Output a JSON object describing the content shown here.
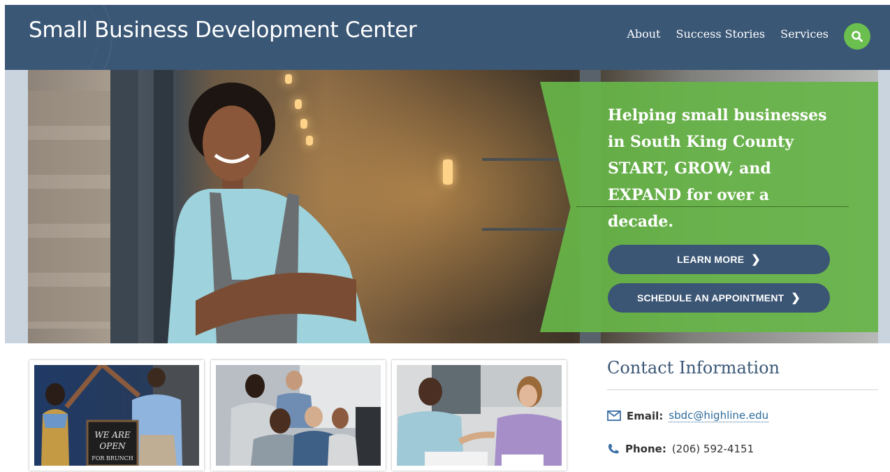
{
  "header": {
    "title": "Small Business Development Center",
    "nav": [
      {
        "label": "About"
      },
      {
        "label": "Success Stories"
      },
      {
        "label": "Services"
      }
    ],
    "search_icon": "search-icon",
    "bg_color": "#3a5776",
    "accent_color": "#6bbf4e"
  },
  "hero": {
    "tagline": "Helping small businesses in South King County START, GROW, and EXPAND for over a decade.",
    "buttons": [
      {
        "label": "LEARN MORE"
      },
      {
        "label": "SCHEDULE AN APPOINTMENT"
      }
    ],
    "banner_color": "#67b548"
  },
  "thumbnails": [
    {
      "sign_text": "WE ARE OPEN FOR BRUNCH"
    },
    {},
    {}
  ],
  "contact": {
    "title": "Contact Information",
    "email_label": "Email:",
    "email_value": "sbdc@highline.edu",
    "phone_label": "Phone:",
    "phone_value": "(206) 592-4151"
  }
}
